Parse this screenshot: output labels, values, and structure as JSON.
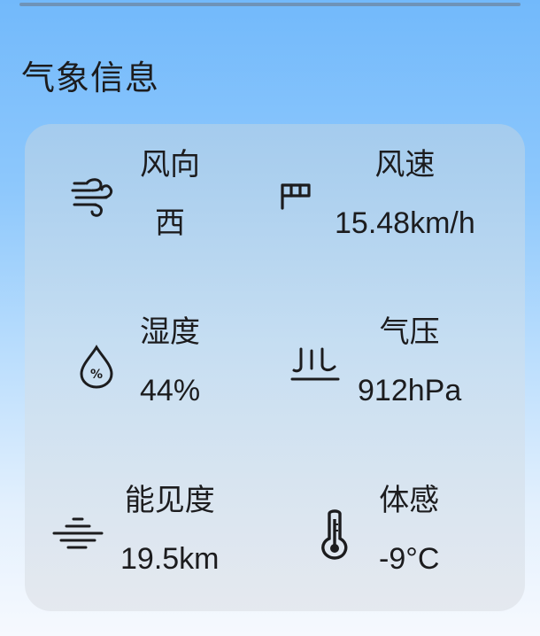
{
  "section": {
    "title": "气象信息"
  },
  "weather": {
    "wind_direction": {
      "label": "风向",
      "value": "西",
      "icon": "wind-icon"
    },
    "wind_speed": {
      "label": "风速",
      "value": "15.48km/h",
      "icon": "windsock-icon"
    },
    "humidity": {
      "label": "湿度",
      "value": "44%",
      "icon": "humidity-drop-icon"
    },
    "pressure": {
      "label": "气压",
      "value": "912hPa",
      "icon": "pressure-icon"
    },
    "visibility": {
      "label": "能见度",
      "value": "19.5km",
      "icon": "fog-lines-icon"
    },
    "feels_like": {
      "label": "体感",
      "value": "-9°C",
      "icon": "thermometer-icon"
    }
  },
  "colors": {
    "text": "#1c1c1e",
    "background_top": "#72b9fb",
    "background_bottom": "#f6f9fe"
  }
}
